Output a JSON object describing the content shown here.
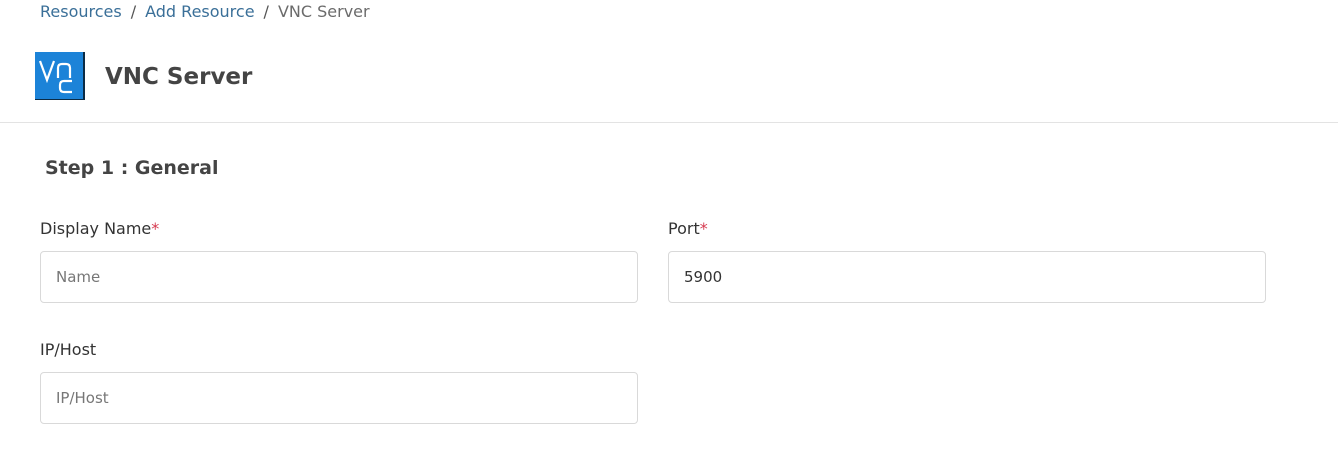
{
  "breadcrumb": {
    "items": [
      "Resources",
      "Add Resource"
    ],
    "separator": "/",
    "current": "VNC Server"
  },
  "header": {
    "title": "VNC Server",
    "logo_icon": "vnc-logo-icon",
    "logo_color": "#1c83d8"
  },
  "step": {
    "title": "Step 1 : General"
  },
  "form": {
    "display_name": {
      "label": "Display Name",
      "required_mark": "*",
      "placeholder": "Name",
      "value": ""
    },
    "port": {
      "label": "Port",
      "required_mark": "*",
      "placeholder": "",
      "value": "5900"
    },
    "ip_host": {
      "label": "IP/Host",
      "placeholder": "IP/Host",
      "value": ""
    }
  },
  "colors": {
    "link": "#3a6f98",
    "required": "#d63a4f",
    "title": "#444444"
  }
}
